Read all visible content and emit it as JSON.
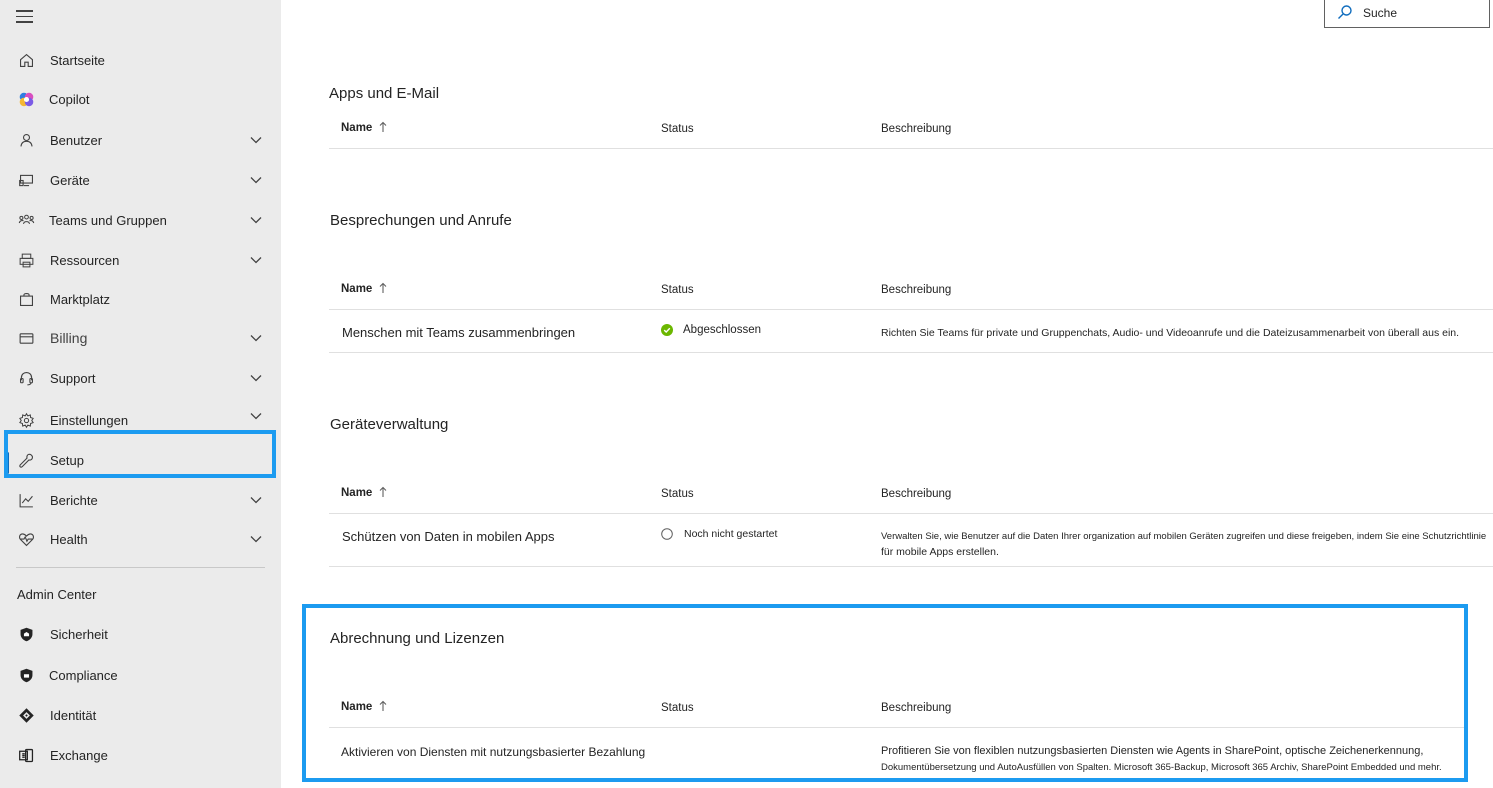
{
  "search": {
    "placeholder": "Suche"
  },
  "sidebar": {
    "items": [
      {
        "label": "Startseite",
        "icon": "home-icon"
      },
      {
        "label": "Copilot",
        "icon": "copilot-icon"
      },
      {
        "label": "Benutzer",
        "icon": "user-icon"
      },
      {
        "label": "Geräte",
        "icon": "devices-icon"
      },
      {
        "label": "Teams und Gruppen",
        "icon": "people-team-icon"
      },
      {
        "label": "Ressourcen",
        "icon": "printer-icon"
      },
      {
        "label": "Marktplatz",
        "icon": "shopping-bag-icon"
      },
      {
        "label": "Billing",
        "icon": "credit-card-icon"
      },
      {
        "label": "Support",
        "icon": "headset-icon"
      },
      {
        "label": "Einstellungen",
        "icon": "gear-icon"
      },
      {
        "label": "Setup",
        "icon": "wrench-icon"
      },
      {
        "label": "Berichte",
        "icon": "chart-icon"
      },
      {
        "label": "Health",
        "icon": "heart-pulse-icon"
      }
    ],
    "admin_header": "Admin Center",
    "admin_items": [
      {
        "label": "Sicherheit",
        "icon": "shield-icon"
      },
      {
        "label": "Compliance",
        "icon": "shield-icon"
      },
      {
        "label": "Identität",
        "icon": "diamond-icon"
      },
      {
        "label": "Exchange",
        "icon": "exchange-icon"
      }
    ]
  },
  "columns": {
    "name": "Name",
    "status": "Status",
    "description": "Beschreibung"
  },
  "sections": [
    {
      "title": "Apps und E-Mail",
      "rows": []
    },
    {
      "title": "Besprechungen und Anrufe",
      "rows": [
        {
          "name": "Menschen mit Teams zusammenbringen",
          "status": "Abgeschlossen",
          "status_kind": "completed",
          "description": "Richten Sie Teams für private und Gruppenchats, Audio- und Videoanrufe und die Dateizusammenarbeit von überall aus ein."
        }
      ]
    },
    {
      "title": "Geräteverwaltung",
      "rows": [
        {
          "name": "Schützen von Daten in mobilen Apps",
          "status": "Noch nicht gestartet",
          "status_kind": "not-started",
          "description_line1": "Verwalten Sie, wie Benutzer auf die Daten Ihrer organization auf mobilen Geräten zugreifen und diese freigeben, indem Sie eine Schutzrichtlinie",
          "description_line2": "für mobile Apps erstellen."
        }
      ]
    },
    {
      "title": "Abrechnung und Lizenzen",
      "rows": [
        {
          "name": "Aktivieren von Diensten mit nutzungsbasierter Bezahlung",
          "status": "",
          "description_line1": "Profitieren Sie von flexiblen nutzungsbasierten Diensten wie Agents in SharePoint, optische Zeichenerkennung,",
          "description_line2": "Dokumentübersetzung und AutoAusfüllen von Spalten. Microsoft 365-Backup, Microsoft 365 Archiv, SharePoint Embedded und mehr."
        }
      ]
    }
  ],
  "colors": {
    "accent": "#0f6cbd",
    "highlight": "#1c9bf0",
    "success": "#6bb700"
  }
}
